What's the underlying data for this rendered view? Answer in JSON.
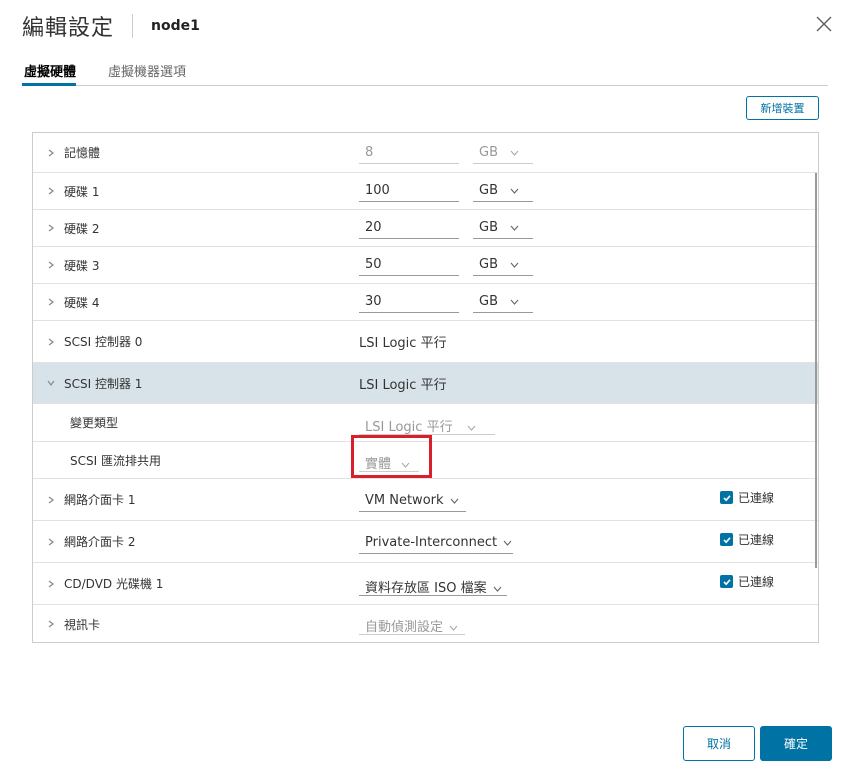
{
  "dialog": {
    "title": "編輯設定",
    "vm_name": "node1"
  },
  "tabs": [
    {
      "label": "虛擬硬體",
      "active": true
    },
    {
      "label": "虛擬機器選項",
      "active": false
    }
  ],
  "toolbar": {
    "add_device_label": "新增裝置"
  },
  "hardware": {
    "memory": {
      "label": "記憶體",
      "value": "8",
      "unit": "GB"
    },
    "disks": [
      {
        "label": "硬碟 1",
        "value": "100",
        "unit": "GB"
      },
      {
        "label": "硬碟 2",
        "value": "20",
        "unit": "GB"
      },
      {
        "label": "硬碟 3",
        "value": "50",
        "unit": "GB"
      },
      {
        "label": "硬碟 4",
        "value": "30",
        "unit": "GB"
      }
    ],
    "scsi0": {
      "label": "SCSI 控制器 0",
      "value": "LSI Logic 平行"
    },
    "scsi1": {
      "label": "SCSI 控制器 1",
      "value": "LSI Logic 平行",
      "change_type_label": "變更類型",
      "change_type_value": "LSI Logic 平行",
      "bus_sharing_label": "SCSI 匯流排共用",
      "bus_sharing_value": "實體"
    },
    "nics": [
      {
        "label": "網路介面卡 1",
        "value": "VM Network",
        "connected_label": "已連線"
      },
      {
        "label": "網路介面卡 2",
        "value": "Private-Interconnect",
        "connected_label": "已連線"
      }
    ],
    "cdrom": {
      "label": "CD/DVD 光碟機 1",
      "value": "資料存放區 ISO 檔案",
      "connected_label": "已連線"
    },
    "video": {
      "label": "視訊卡",
      "value": "自動偵測設定"
    }
  },
  "footer": {
    "cancel_label": "取消",
    "ok_label": "確定"
  },
  "colors": {
    "accent": "#0072a3",
    "selected_row": "#d8e3e9",
    "highlight": "#d9202a"
  }
}
